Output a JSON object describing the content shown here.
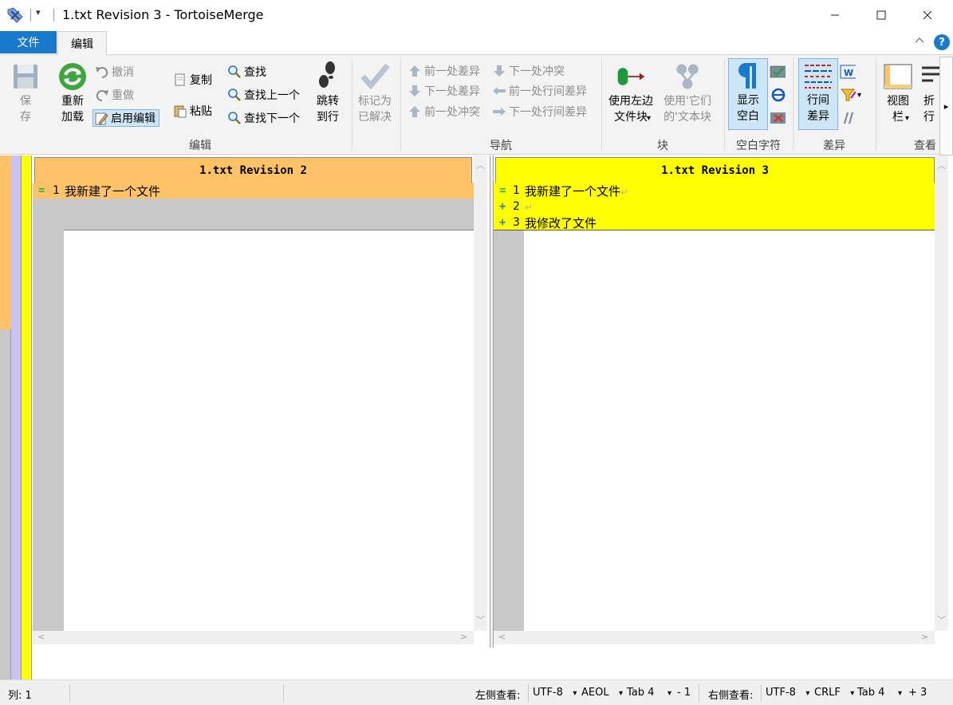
{
  "window": {
    "title": "1.txt Revision 3 - TortoiseMerge",
    "quick_access_arrow": "▾",
    "minimize": "─",
    "maximize": "☐",
    "close": "✕"
  },
  "ribbon_tabs": {
    "file": "文件",
    "edit": "编辑",
    "collapse": "^",
    "help": "?"
  },
  "ribbon": {
    "save": "保\n存",
    "reload": "重新\n加载",
    "undo": "撤消",
    "redo": "重做",
    "enable_edit": "启用编辑",
    "copy": "复制",
    "paste": "粘贴",
    "find": "查找",
    "find_prev": "查找上一个",
    "find_next": "查找下一个",
    "goto_line": "跳转\n到行",
    "mark_resolved": "标记为\n已解决",
    "group_edit": "编辑",
    "prev_diff": "前一处差异",
    "next_diff": "下一处差异",
    "prev_conflict": "前一处冲突",
    "next_conflict": "下一处冲突",
    "prev_inline_diff": "前一处行间差异",
    "next_inline_diff": "下一处行间差异",
    "group_nav": "导航",
    "use_left_block": "使用左边\n文件块",
    "use_their_block": "使用'它们\n的'文本块",
    "group_block": "块",
    "show_whitespace": "显示\n空白",
    "group_whitespace": "空白字符",
    "inline_diff": "行间\n差异",
    "group_diff": "差异",
    "view_bar": "视图\n栏",
    "wrap_partial": "折\n行",
    "group_view": "查看",
    "more_arrow": "▸"
  },
  "left_pane": {
    "header": "1.txt Revision 2",
    "lines": [
      {
        "mark": "=",
        "num": "1",
        "text": "我新建了一个文件"
      }
    ]
  },
  "right_pane": {
    "header": "1.txt Revision 3",
    "lines": [
      {
        "mark": "=",
        "num": "1",
        "text": "我新建了一个文件",
        "eol": "↵"
      },
      {
        "mark": "+",
        "num": "2",
        "text": "",
        "eol": "↵"
      },
      {
        "mark": "+",
        "num": "3",
        "text": "我修改了文件",
        "eol": ""
      }
    ]
  },
  "statusbar": {
    "col": "列: 1",
    "left_view_label": "左侧查看:",
    "left_encoding": "UTF-8",
    "left_eol": "AEOL",
    "left_tab": "Tab 4",
    "left_count": "- 1",
    "right_view_label": "右侧查看:",
    "right_encoding": "UTF-8",
    "right_eol": "CRLF",
    "right_tab": "Tab 4",
    "right_count": "+ 3",
    "dropdown_arrow": "▾"
  },
  "colors": {
    "left_diff_bg": "#ffc266",
    "right_diff_bg": "#ffff00",
    "gutter_grey": "#c8c8c8",
    "file_tab": "#1979ca",
    "equal_mark": "#2eb24e",
    "plus_mark": "#2a8aa8"
  }
}
